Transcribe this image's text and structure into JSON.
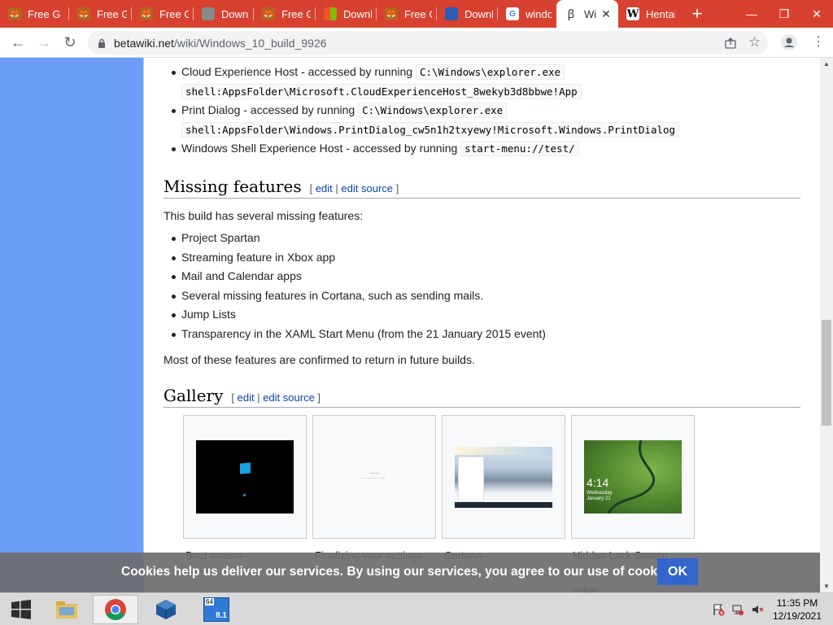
{
  "browser": {
    "tabs": [
      {
        "label": "Free G",
        "icon": "game-icon",
        "color": "#b5651d"
      },
      {
        "label": "Free G",
        "icon": "game-icon",
        "color": "#b5651d"
      },
      {
        "label": "Free G",
        "icon": "game-icon",
        "color": "#b5651d"
      },
      {
        "label": "Downl",
        "icon": "download-icon",
        "color": "#8a8a8a"
      },
      {
        "label": "Free G",
        "icon": "game-icon",
        "color": "#b5651d"
      },
      {
        "label": "Downl",
        "icon": "windows-icon",
        "color": "#2f8fd8"
      },
      {
        "label": "Free G",
        "icon": "game-icon",
        "color": "#b5651d"
      },
      {
        "label": "Downl",
        "icon": "download-icon",
        "color": "#2a5db0"
      },
      {
        "label": "windo",
        "icon": "google-icon",
        "color": "#ffffff"
      },
      {
        "label": "Wi",
        "icon": "betawiki-icon",
        "color": "#ffffff"
      },
      {
        "label": "Hentai",
        "icon": "wikipedia-icon",
        "color": "#ffffff"
      }
    ],
    "url_domain": "betawiki.net",
    "url_path": "/wiki/Windows_10_build_9926"
  },
  "article": {
    "list1": [
      {
        "text": "Cloud Experience Host - accessed by running ",
        "code1": "C:\\Windows\\explorer.exe",
        "code2": "shell:AppsFolder\\Microsoft.CloudExperienceHost_8wekyb3d8bbwe!App"
      },
      {
        "text": "Print Dialog - accessed by running ",
        "code1": "C:\\Windows\\explorer.exe",
        "code2": "shell:AppsFolder\\Windows.PrintDialog_cw5n1h2txyewy!Microsoft.Windows.PrintDialog"
      },
      {
        "text": "Windows Shell Experience Host - accessed by running ",
        "code1": "start-menu://test/"
      }
    ],
    "missing": {
      "heading": "Missing features",
      "edit": "edit",
      "edit_source": "edit source",
      "intro": "This build has several missing features:",
      "items": [
        "Project Spartan",
        "Streaming feature in Xbox app",
        "Mail and Calendar apps",
        "Several missing features in Cortana, such as sending mails.",
        "Jump Lists",
        "Transparency in the XAML Start Menu (from the 21 January 2015 event)"
      ],
      "outro": "Most of these features are confirmed to return in future builds."
    },
    "gallery": {
      "heading": "Gallery",
      "edit": "edit",
      "edit_source": "edit source",
      "items": [
        {
          "caption": "Boot screen"
        },
        {
          "caption": "Finalizing your settings"
        },
        {
          "caption": "Cortana"
        },
        {
          "caption": "Hidden Lock Screen"
        }
      ],
      "lock_time": "4:14",
      "lock_day": "Wednesday",
      "lock_date": "January 21",
      "caption_overflow": "value"
    }
  },
  "cookie": {
    "text": "Cookies help us deliver our services. By using our services, you agree to our use of cookies.",
    "ok": "OK"
  },
  "taskbar": {
    "time": "11:35 PM",
    "date": "12/19/2021",
    "vbox_label": "8.1",
    "vbox_badge": "64"
  }
}
